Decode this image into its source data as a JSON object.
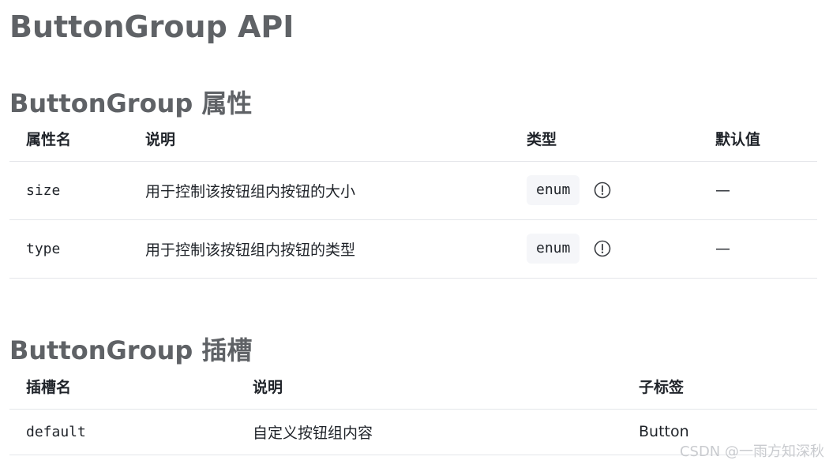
{
  "page": {
    "title": "ButtonGroup API"
  },
  "props_section": {
    "heading": "ButtonGroup 属性",
    "columns": [
      "属性名",
      "说明",
      "类型",
      "默认值"
    ],
    "rows": [
      {
        "name": "size",
        "description": "用于控制该按钮组内按钮的大小",
        "type": "enum",
        "default": "—"
      },
      {
        "name": "type",
        "description": "用于控制该按钮组内按钮的类型",
        "type": "enum",
        "default": "—"
      }
    ]
  },
  "slots_section": {
    "heading": "ButtonGroup 插槽",
    "columns": [
      "插槽名",
      "说明",
      "子标签"
    ],
    "rows": [
      {
        "name": "default",
        "description": "自定义按钮组内容",
        "child_tag": "Button"
      }
    ]
  },
  "watermark": "CSDN @一雨方知深秋",
  "icons": {
    "type_info": "info-circle-icon"
  },
  "colors": {
    "heading": "#5f6266",
    "text": "#1f2329",
    "divider": "#e4e6ea",
    "chip_bg": "#f5f6f9"
  }
}
